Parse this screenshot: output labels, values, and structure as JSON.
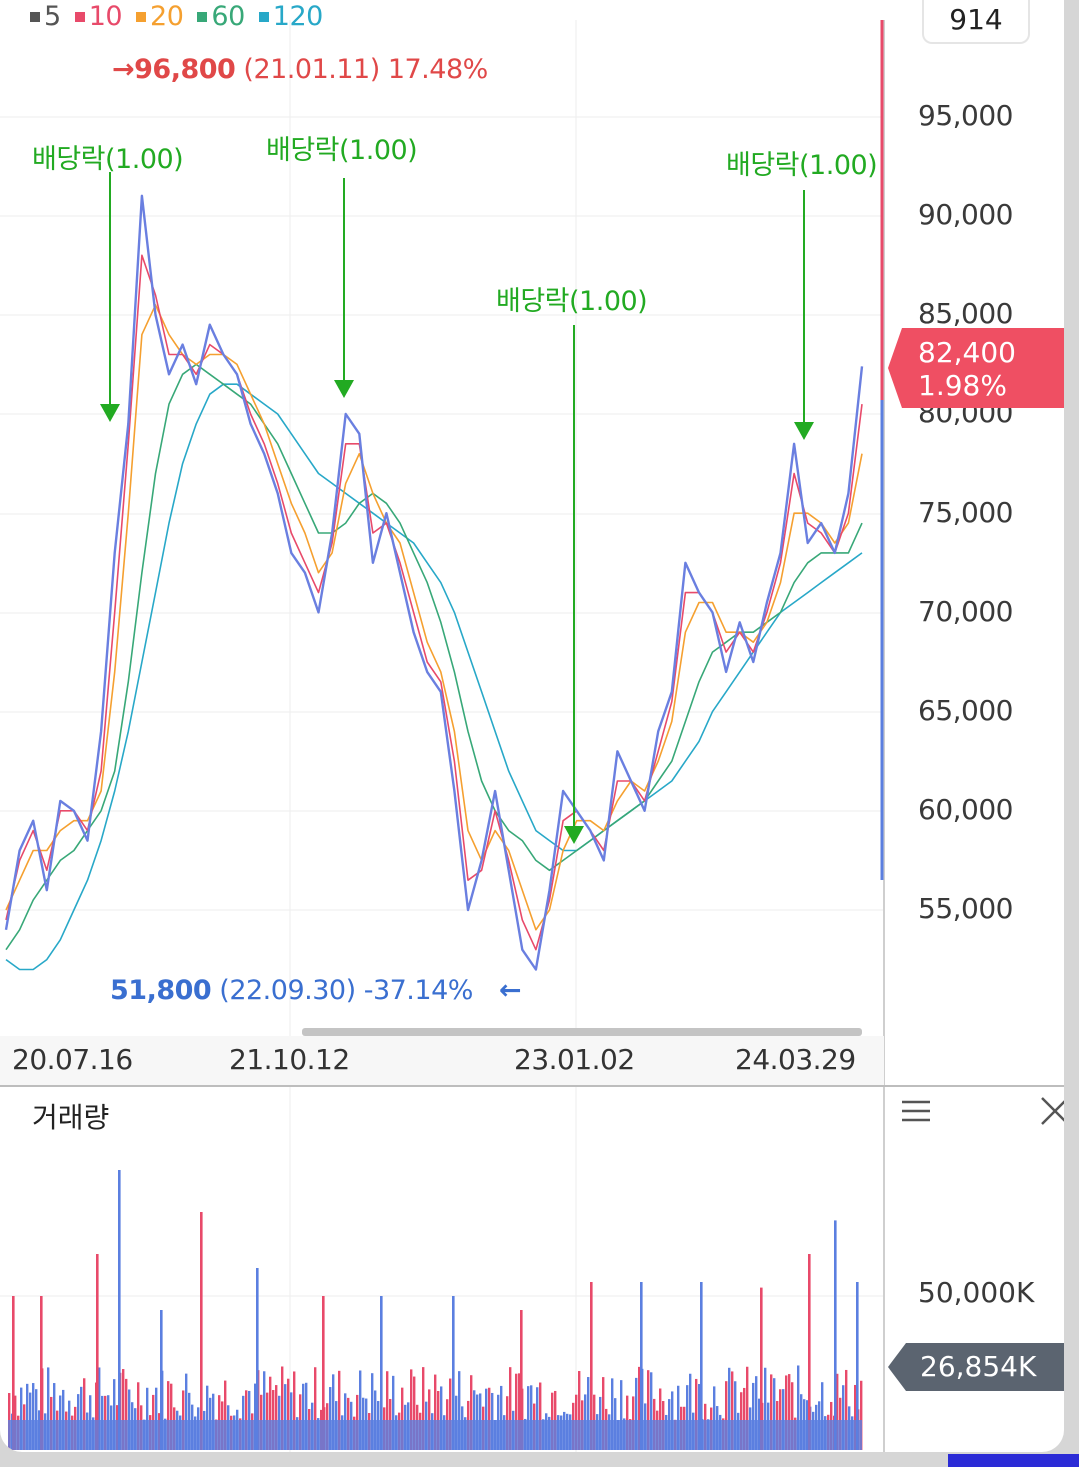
{
  "legend": [
    {
      "label": "5",
      "color": "#555555"
    },
    {
      "label": "10",
      "color": "#e84a6a"
    },
    {
      "label": "20",
      "color": "#f5a030"
    },
    {
      "label": "60",
      "color": "#38a878"
    },
    {
      "label": "120",
      "color": "#28a8c8"
    }
  ],
  "header": {
    "count": "914"
  },
  "chart_data": {
    "type": "line",
    "price_axis": [
      "95,000",
      "90,000",
      "85,000",
      "80,000",
      "75,000",
      "70,000",
      "65,000",
      "60,000",
      "55,000"
    ],
    "date_axis": [
      "20.07.16",
      "21.10.12",
      "23.01.02",
      "24.03.29"
    ],
    "ylim": [
      49000,
      99000
    ],
    "series": [
      {
        "name": "5",
        "color": "#6a7fe0",
        "values": [
          54000,
          58000,
          59500,
          56000,
          60500,
          60000,
          58500,
          64000,
          73000,
          79500,
          91000,
          85000,
          82000,
          83500,
          81500,
          84500,
          83000,
          82000,
          79500,
          78000,
          76000,
          73000,
          72000,
          70000,
          74000,
          80000,
          79000,
          72500,
          75000,
          72000,
          69000,
          67000,
          66000,
          61000,
          55000,
          57500,
          61000,
          57000,
          53000,
          52000,
          56000,
          61000,
          60000,
          59000,
          57500,
          63000,
          61500,
          60000,
          64000,
          66000,
          72500,
          71000,
          70000,
          67000,
          69500,
          67500,
          70500,
          73000,
          78500,
          73500,
          74500,
          73000,
          76000,
          82400
        ]
      },
      {
        "name": "10",
        "color": "#e84a6a",
        "values": [
          54500,
          57500,
          59000,
          57000,
          60000,
          60000,
          59000,
          62000,
          70000,
          78500,
          88000,
          86000,
          83000,
          83000,
          82000,
          83500,
          83000,
          82000,
          80000,
          78500,
          76500,
          74000,
          72500,
          71000,
          73500,
          78500,
          78500,
          74000,
          74500,
          72500,
          70000,
          67500,
          66500,
          62500,
          56500,
          57000,
          60000,
          57500,
          54500,
          53000,
          55500,
          59500,
          60000,
          59000,
          58000,
          61500,
          61500,
          60500,
          63000,
          65500,
          71000,
          71000,
          70000,
          68000,
          69000,
          68000,
          70000,
          72500,
          77000,
          74500,
          74000,
          73000,
          75000,
          80500
        ]
      },
      {
        "name": "20",
        "color": "#f5a030",
        "values": [
          55000,
          56500,
          58000,
          58000,
          59000,
          59500,
          59500,
          61000,
          67000,
          75000,
          84000,
          85500,
          84000,
          83000,
          82500,
          83000,
          83000,
          82500,
          81000,
          79500,
          77500,
          75500,
          74000,
          72000,
          73000,
          76500,
          78000,
          76000,
          74500,
          73500,
          71000,
          68500,
          67000,
          64000,
          59000,
          57500,
          59000,
          58000,
          56000,
          54000,
          55000,
          58000,
          59500,
          59500,
          59000,
          60500,
          61500,
          61000,
          62500,
          64500,
          69000,
          70500,
          70500,
          69000,
          69000,
          68500,
          69500,
          71500,
          75000,
          75000,
          74500,
          73500,
          74500,
          78000
        ]
      },
      {
        "name": "60",
        "color": "#38a878",
        "values": [
          53000,
          54000,
          55500,
          56500,
          57500,
          58000,
          59000,
          60000,
          62000,
          66500,
          72000,
          77000,
          80500,
          82000,
          82500,
          82000,
          81500,
          81000,
          80500,
          79500,
          78500,
          77000,
          75500,
          74000,
          74000,
          74500,
          75500,
          76000,
          75500,
          74500,
          73000,
          71500,
          69500,
          67000,
          64000,
          61500,
          60000,
          59000,
          58500,
          57500,
          57000,
          57500,
          58000,
          58500,
          59000,
          59500,
          60000,
          60500,
          61500,
          62500,
          64500,
          66500,
          68000,
          68500,
          69000,
          69000,
          69500,
          70000,
          71500,
          72500,
          73000,
          73000,
          73000,
          74500
        ]
      },
      {
        "name": "120",
        "color": "#28a8c8",
        "values": [
          52500,
          52000,
          52000,
          52500,
          53500,
          55000,
          56500,
          58500,
          61000,
          64000,
          67500,
          71000,
          74500,
          77500,
          79500,
          81000,
          81500,
          81500,
          81000,
          80500,
          80000,
          79000,
          78000,
          77000,
          76500,
          76000,
          75500,
          75000,
          74500,
          74000,
          73500,
          72500,
          71500,
          70000,
          68000,
          66000,
          64000,
          62000,
          60500,
          59000,
          58500,
          58000,
          58000,
          58500,
          59000,
          59500,
          60000,
          60500,
          61000,
          61500,
          62500,
          63500,
          65000,
          66000,
          67000,
          68000,
          69000,
          70000,
          70500,
          71000,
          71500,
          72000,
          72500,
          73000
        ]
      }
    ],
    "annotations": {
      "high": {
        "price": "96,800",
        "date": "(21.01.11)",
        "pct": "17.48%"
      },
      "low": {
        "price": "51,800",
        "date": "(22.09.30)",
        "pct": "-37.14%"
      },
      "dividends": [
        "배당락(1.00)",
        "배당락(1.00)",
        "배당락(1.00)",
        "배당락(1.00)"
      ]
    },
    "current": {
      "price": "82,400",
      "change": "1.98%"
    }
  },
  "volume": {
    "title": "거래량",
    "axis_label": "50,000K",
    "current": "26,854K",
    "spikes": [
      0.55,
      1.0,
      0.7,
      0.65,
      0.55,
      0.55,
      0.6,
      0.6,
      0.7,
      0.6,
      0.55,
      0.5,
      0.85,
      0.55,
      0.5,
      0.6,
      0.58,
      0.82
    ]
  }
}
